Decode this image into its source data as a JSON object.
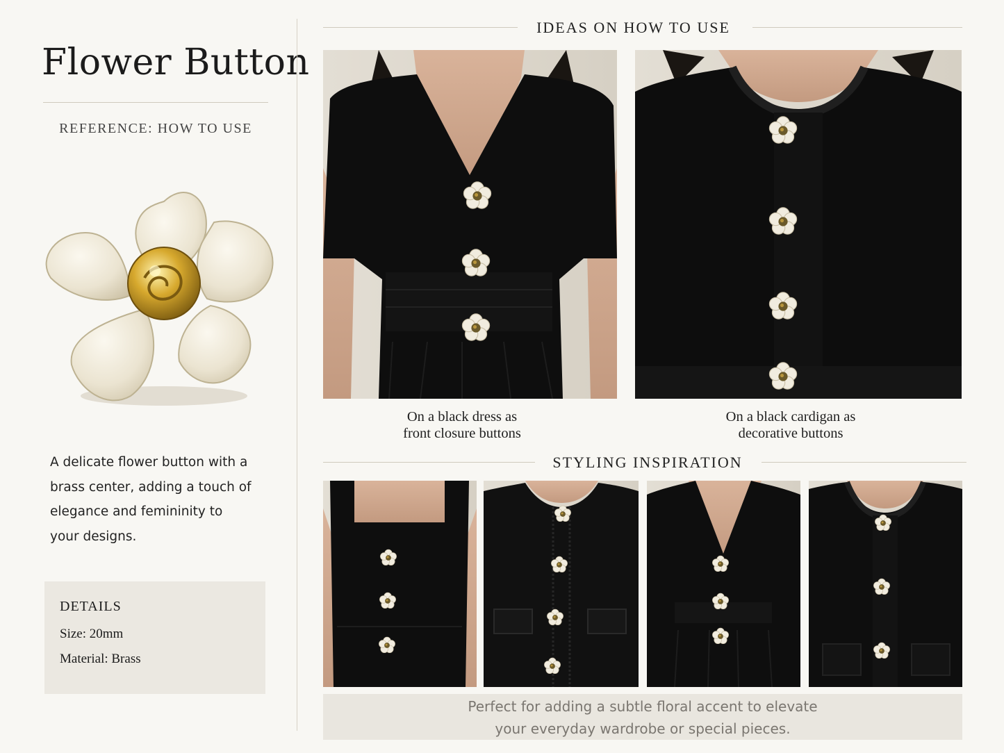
{
  "product": {
    "title": "Flower Button",
    "subtitle": "REFERENCE: HOW TO USE",
    "description": "A delicate flower button with a brass center, adding a touch of elegance and femininity to your designs.",
    "description_lines": [
      "A delicate flower button with a",
      "brass center, adding a touch of",
      "elegance and femininity to",
      "your designs."
    ],
    "image": "flower-button-photo"
  },
  "details": {
    "heading": "DETAILS",
    "size": "Size: 20mm",
    "material": "Material: Brass"
  },
  "ideas": {
    "heading": "IDEAS ON HOW TO USE",
    "items": [
      {
        "caption_line1": "On a black dress as",
        "caption_line2": "front closure buttons",
        "image": "black-dress-photo"
      },
      {
        "caption_line1": "On a black cardigan as",
        "caption_line2": "decorative buttons",
        "image": "black-cardigan-photo"
      }
    ]
  },
  "styling": {
    "heading": "STYLING INSPIRATION",
    "images": [
      "square-neck-dress-photo",
      "tweed-jacket-photo",
      "long-sleeve-dress-photo",
      "knit-cardigan-photo"
    ]
  },
  "footer": {
    "line1": "Perfect for adding a subtle floral accent to elevate",
    "line2": "your everyday wardrobe or special pieces."
  },
  "colors": {
    "background": "#f8f7f3",
    "panel": "#ebe8e1",
    "garment": "#0d0d0d",
    "button_enamel": "#eee8d8",
    "brass": "#c9a23a"
  }
}
